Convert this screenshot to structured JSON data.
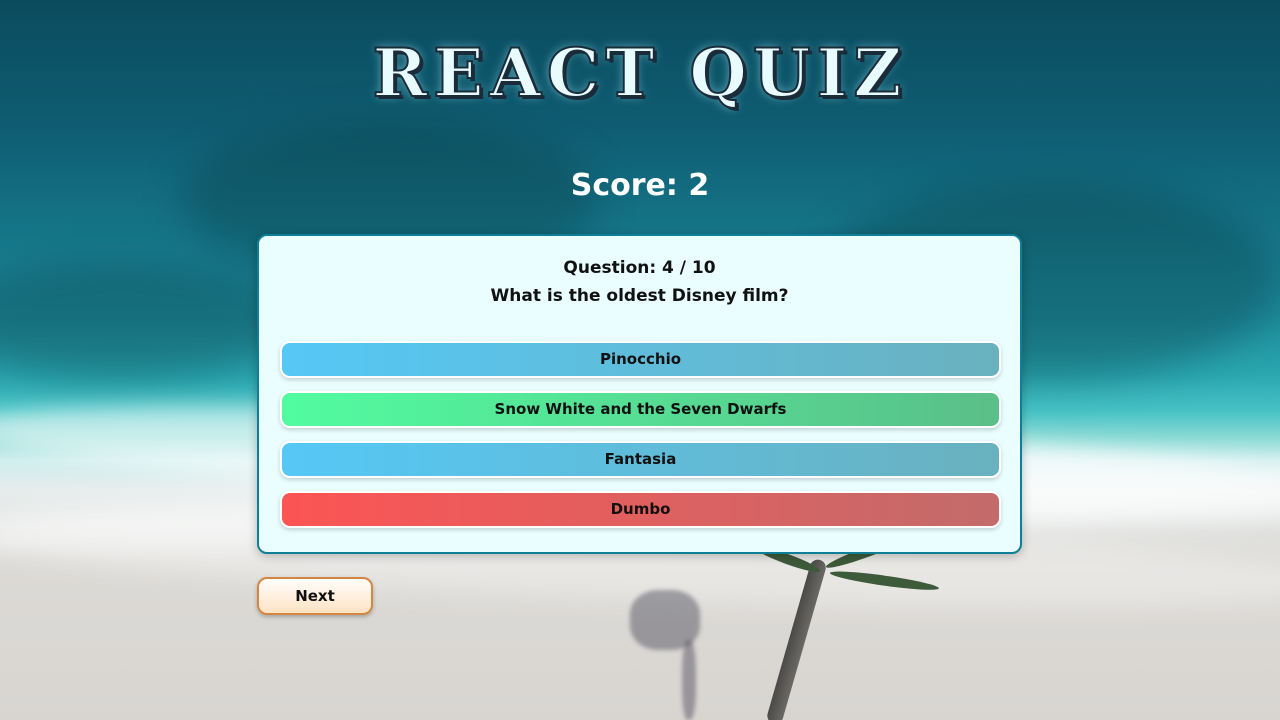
{
  "app": {
    "title": "REACT QUIZ"
  },
  "score": {
    "label": "Score: 2"
  },
  "quiz": {
    "question_number": "Question: 4 / 10",
    "question_text": "What is the oldest Disney film?",
    "answers": [
      {
        "label": "Pinocchio",
        "state": "neutral",
        "color_start": "#55c8f6",
        "color_end": "#6ab1bf"
      },
      {
        "label": "Snow White and the Seven Dwarfs",
        "state": "correct",
        "color_start": "#51fca0",
        "color_end": "#5abf88"
      },
      {
        "label": "Fantasia",
        "state": "neutral",
        "color_start": "#55c8f6",
        "color_end": "#6ab1bf"
      },
      {
        "label": "Dumbo",
        "state": "wrong",
        "color_start": "#fd5454",
        "color_end": "#c36b6b"
      }
    ]
  },
  "controls": {
    "next_label": "Next"
  },
  "colors": {
    "card_background": "#eafeff",
    "card_border": "#0e7f97",
    "next_border": "#d38743"
  }
}
